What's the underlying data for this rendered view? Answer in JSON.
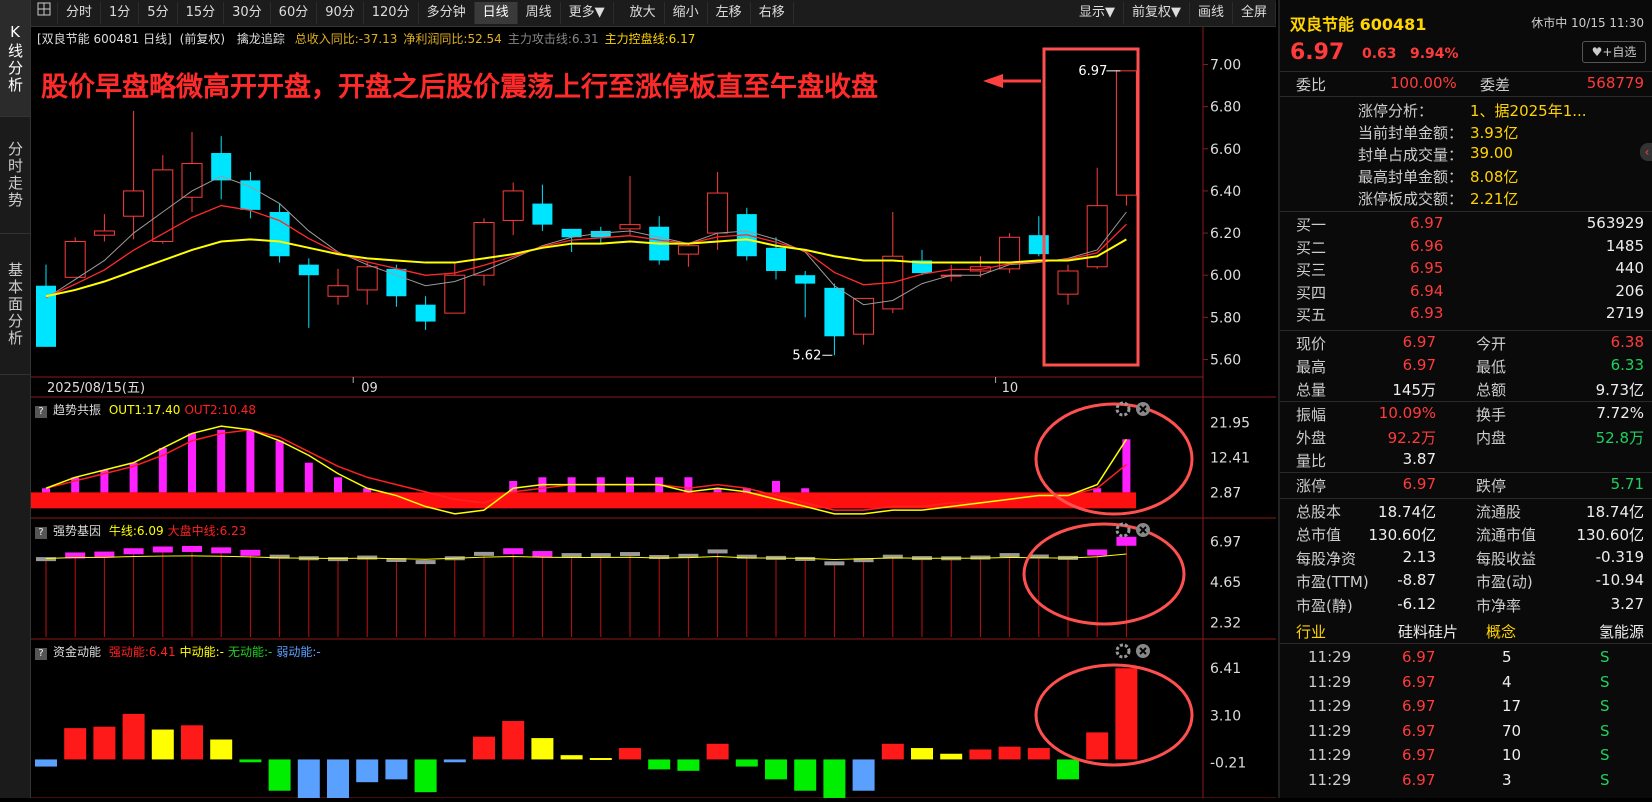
{
  "sidebar": {
    "tabs": [
      "K线分析",
      "分时走势",
      "基本面分析"
    ]
  },
  "toolbar": {
    "periods": [
      "分时",
      "1分",
      "5分",
      "15分",
      "30分",
      "60分",
      "90分",
      "120分",
      "多分钟",
      "日线",
      "周线",
      "更多▼"
    ],
    "selected": "日线",
    "tools": [
      "放大",
      "缩小",
      "左移",
      "右移"
    ],
    "right": [
      "显示▼",
      "前复权▼",
      "画线",
      "全屏"
    ]
  },
  "main_panel": {
    "stock_label": "[双良节能 600481 日线]",
    "adjust": "(前复权)",
    "indicator": "擒龙追踪",
    "metrics": [
      {
        "text": "总收入同比:-37.13",
        "color": "#e0b020"
      },
      {
        "text": "净利润同比:52.54",
        "color": "#e0b020"
      },
      {
        "text": "主力攻击线:6.31",
        "color": "#888888"
      },
      {
        "text": "主力控盘线:6.17",
        "color": "#ffd400"
      }
    ],
    "annotation": "股价早盘略微高开开盘，开盘之后股价震荡上行至涨停板直至午盘收盘",
    "y_ticks": [
      "7.00",
      "6.80",
      "6.60",
      "6.40",
      "6.20",
      "6.00",
      "5.80",
      "5.60"
    ],
    "high_label": "6.97",
    "low_label": "5.62",
    "x_labels": [
      "2025/08/15(五)",
      "09",
      "10"
    ]
  },
  "chart_data": [
    {
      "type": "candlestick",
      "title": "双良节能 600481 日线",
      "ylim": [
        5.55,
        7.05
      ],
      "candles": [
        [
          5.95,
          5.66,
          6.05,
          5.66
        ],
        [
          5.99,
          6.16,
          6.18,
          5.99
        ],
        [
          6.19,
          6.21,
          6.29,
          6.16
        ],
        [
          6.28,
          6.4,
          6.78,
          6.17
        ],
        [
          6.16,
          6.5,
          6.57,
          6.15
        ],
        [
          6.37,
          6.53,
          6.68,
          6.3
        ],
        [
          6.58,
          6.45,
          6.66,
          6.36
        ],
        [
          6.45,
          6.31,
          6.49,
          6.27
        ],
        [
          6.3,
          6.09,
          6.34,
          6.06
        ],
        [
          6.05,
          6.0,
          6.08,
          5.75
        ],
        [
          5.9,
          5.95,
          6.03,
          5.86
        ],
        [
          5.93,
          6.04,
          6.06,
          5.86
        ],
        [
          6.03,
          5.9,
          6.05,
          5.85
        ],
        [
          5.86,
          5.78,
          5.9,
          5.74
        ],
        [
          5.82,
          6.0,
          6.06,
          5.82
        ],
        [
          6.0,
          6.25,
          6.27,
          5.95
        ],
        [
          6.26,
          6.4,
          6.44,
          6.19
        ],
        [
          6.34,
          6.24,
          6.43,
          6.21
        ],
        [
          6.22,
          6.18,
          6.21,
          6.11
        ],
        [
          6.21,
          6.18,
          6.23,
          6.15
        ],
        [
          6.22,
          6.24,
          6.47,
          6.19
        ],
        [
          6.23,
          6.07,
          6.28,
          6.05
        ],
        [
          6.1,
          6.14,
          6.15,
          6.04
        ],
        [
          6.2,
          6.39,
          6.49,
          6.12
        ],
        [
          6.29,
          6.09,
          6.32,
          6.07
        ],
        [
          6.13,
          6.02,
          6.18,
          5.98
        ],
        [
          6.0,
          5.96,
          6.02,
          5.8
        ],
        [
          5.94,
          5.71,
          5.96,
          5.62
        ],
        [
          5.72,
          5.89,
          5.89,
          5.67
        ],
        [
          5.84,
          6.09,
          6.3,
          5.82
        ],
        [
          6.07,
          6.01,
          6.12,
          6.0
        ],
        [
          6.0,
          6.0,
          6.05,
          5.97
        ],
        [
          6.02,
          6.04,
          6.09,
          5.99
        ],
        [
          6.03,
          6.18,
          6.2,
          6.01
        ],
        [
          6.19,
          6.1,
          6.28,
          6.09
        ],
        [
          5.91,
          6.02,
          6.05,
          5.86
        ],
        [
          6.04,
          6.33,
          6.51,
          6.03
        ],
        [
          6.38,
          6.97,
          6.97,
          6.33
        ]
      ],
      "ma_gray": [
        5.89,
        5.98,
        6.07,
        6.2,
        6.3,
        6.4,
        6.47,
        6.42,
        6.34,
        6.21,
        6.11,
        6.05,
        6.0,
        5.95,
        5.97,
        6.02,
        6.08,
        6.14,
        6.18,
        6.2,
        6.21,
        6.18,
        6.15,
        6.2,
        6.21,
        6.17,
        6.11,
        5.95,
        5.86,
        5.88,
        5.96,
        6.0,
        6.0,
        6.05,
        6.06,
        6.08,
        6.12,
        6.3
      ],
      "ma_red": [
        5.89,
        5.98,
        6.07,
        6.2,
        6.3,
        6.4,
        6.47,
        6.42,
        6.34,
        6.21,
        6.11,
        6.05,
        6.0,
        5.95,
        5.97,
        6.02,
        6.08,
        6.14,
        6.18,
        6.2,
        6.21,
        6.18,
        6.15,
        6.2,
        6.21,
        6.17,
        6.11,
        5.95,
        5.86,
        5.88,
        5.96,
        6.0,
        6.0,
        6.05,
        6.06,
        6.08,
        6.12,
        6.3
      ],
      "ma_yellow": [
        5.9,
        5.93,
        5.97,
        6.02,
        6.07,
        6.12,
        6.16,
        6.17,
        6.16,
        6.13,
        6.1,
        6.08,
        6.07,
        6.06,
        6.06,
        6.08,
        6.1,
        6.13,
        6.15,
        6.15,
        6.16,
        6.15,
        6.15,
        6.16,
        6.17,
        6.14,
        6.12,
        6.09,
        6.07,
        6.07,
        6.06,
        6.06,
        6.06,
        6.06,
        6.07,
        6.07,
        6.09,
        6.17
      ]
    },
    {
      "type": "bar",
      "title": "趋势共振",
      "ylim": [
        -2.5,
        23.5
      ],
      "y_ticks": [
        "21.95",
        "12.41",
        "2.87"
      ],
      "series": [
        {
          "name": "OUT1",
          "label": "OUT1:17.40",
          "color": "#ffff00"
        },
        {
          "name": "OUT2",
          "label": "OUT2:10.48",
          "color": "#ff2020"
        }
      ],
      "bars": [
        4,
        7,
        9,
        11,
        15,
        19,
        20,
        20,
        17,
        11,
        7,
        4,
        2,
        0,
        0,
        0,
        6,
        7,
        7,
        7,
        7,
        7,
        7,
        4,
        4,
        6,
        4,
        0,
        0,
        0,
        0,
        0,
        0,
        0,
        0,
        0,
        4,
        17.4
      ],
      "line_yellow": [
        4,
        7,
        9,
        11,
        15,
        19,
        21,
        20,
        17,
        13,
        8,
        4,
        2,
        -1,
        -3,
        -2,
        4,
        5,
        5,
        5,
        5,
        5,
        3,
        4,
        3,
        1,
        -1,
        -3,
        -3,
        -2,
        -2,
        -1,
        0,
        1,
        2,
        2,
        5,
        17.4
      ],
      "line_red": [
        4,
        6,
        8,
        10,
        13,
        17,
        19,
        20,
        18,
        14,
        10,
        7,
        5,
        3,
        1,
        0,
        3,
        4,
        5,
        5,
        5,
        5,
        4,
        5,
        4,
        2,
        0,
        -2,
        -2,
        -1,
        -1,
        0,
        0,
        1,
        2,
        2,
        4,
        10.48
      ],
      "band": [
        0,
        2.87
      ]
    },
    {
      "type": "bar",
      "title": "强势基因",
      "ylim": [
        1.5,
        7.5
      ],
      "y_ticks": [
        "6.97",
        "4.65",
        "2.32"
      ],
      "series": [
        {
          "name": "牛线",
          "label": "牛线:6.09",
          "color": "#ffff00"
        },
        {
          "name": "大盘中线",
          "label": "大盘中线:6.23",
          "color": "#ff2020"
        }
      ],
      "values": [
        5.95,
        6.16,
        6.21,
        6.4,
        6.5,
        6.53,
        6.45,
        6.31,
        6.09,
        6.0,
        5.95,
        6.04,
        5.9,
        5.78,
        6.0,
        6.25,
        6.4,
        6.24,
        6.18,
        6.18,
        6.24,
        6.07,
        6.14,
        6.39,
        6.09,
        6.02,
        5.96,
        5.71,
        5.89,
        6.09,
        6.01,
        6.0,
        6.04,
        6.18,
        6.1,
        6.02,
        6.33,
        6.97
      ],
      "strong": [
        0,
        1,
        1,
        1,
        1,
        1,
        1,
        1,
        0,
        0,
        0,
        0,
        0,
        0,
        0,
        0,
        1,
        1,
        0,
        0,
        0,
        0,
        0,
        0,
        0,
        0,
        0,
        0,
        0,
        0,
        0,
        0,
        0,
        0,
        0,
        0,
        1,
        1
      ]
    },
    {
      "type": "bar",
      "title": "资金动能",
      "ylim": [
        -2.5,
        7.2
      ],
      "y_ticks": [
        "6.41",
        "3.10",
        "-0.21"
      ],
      "series": [
        {
          "name": "强动能",
          "label": "强动能:6.41",
          "color": "#ff2020"
        },
        {
          "name": "中动能",
          "label": "中动能:-",
          "color": "#ffff00"
        },
        {
          "name": "无动能",
          "label": "无动能:-",
          "color": "#20d020"
        },
        {
          "name": "弱动能",
          "label": "弱动能:-",
          "color": "#5aa0ff"
        }
      ],
      "values": [
        -0.5,
        2.2,
        2.3,
        3.2,
        2.1,
        2.4,
        1.4,
        -0.2,
        -2.2,
        -3.2,
        -2.8,
        -1.6,
        -1.4,
        -2.3,
        -0.2,
        1.6,
        2.7,
        1.5,
        0.3,
        0.1,
        0.8,
        -0.7,
        -0.8,
        1.1,
        -0.5,
        -1.4,
        -2.2,
        -3.1,
        -2.2,
        1.1,
        0.8,
        0.4,
        0.7,
        0.9,
        0.8,
        -1.4,
        1.9,
        6.41
      ],
      "kinds": [
        "weak",
        "strong",
        "strong",
        "strong",
        "mid",
        "strong",
        "mid",
        "none",
        "none",
        "weak",
        "weak",
        "weak",
        "weak",
        "none",
        "weak",
        "strong",
        "strong",
        "mid",
        "mid",
        "mid",
        "strong",
        "none",
        "none",
        "strong",
        "none",
        "none",
        "none",
        "none",
        "weak",
        "strong",
        "mid",
        "mid",
        "strong",
        "strong",
        "strong",
        "none",
        "strong",
        "strong"
      ]
    }
  ],
  "quote": {
    "name": "双良节能 600481",
    "status": "休市中 10/15 11:30",
    "price": "6.97",
    "change": "0.63",
    "pct": "9.94%",
    "fav_button": "+自选",
    "weibi_label": "委比",
    "weibi": "100.00%",
    "weicha_label": "委差",
    "weicha": "568779"
  },
  "limit_up": {
    "rows": [
      {
        "label": "涨停分析：",
        "value": "1、据2025年1..."
      },
      {
        "label": "当前封单金额：",
        "value": "3.93亿"
      },
      {
        "label": "封单占成交量：",
        "value": "39.00"
      },
      {
        "label": "最高封单金额：",
        "value": "8.08亿"
      },
      {
        "label": "涨停板成交额：",
        "value": "2.21亿"
      }
    ]
  },
  "order_book": [
    {
      "label": "买一",
      "price": "6.97",
      "vol": "563929"
    },
    {
      "label": "买二",
      "price": "6.96",
      "vol": "1485"
    },
    {
      "label": "买三",
      "price": "6.95",
      "vol": "440"
    },
    {
      "label": "买四",
      "price": "6.94",
      "vol": "206"
    },
    {
      "label": "买五",
      "price": "6.93",
      "vol": "2719"
    }
  ],
  "stats1": [
    {
      "l1": "现价",
      "v1": "6.97",
      "c1": "red",
      "l2": "今开",
      "v2": "6.38",
      "c2": "red"
    },
    {
      "l1": "最高",
      "v1": "6.97",
      "c1": "red",
      "l2": "最低",
      "v2": "6.33",
      "c2": "green"
    },
    {
      "l1": "总量",
      "v1": "145万",
      "c1": "white",
      "l2": "总额",
      "v2": "9.73亿",
      "c2": "white"
    }
  ],
  "stats2": [
    {
      "l1": "振幅",
      "v1": "10.09%",
      "c1": "red",
      "l2": "换手",
      "v2": "7.72%",
      "c2": "white"
    },
    {
      "l1": "外盘",
      "v1": "92.2万",
      "c1": "red",
      "l2": "内盘",
      "v2": "52.8万",
      "c2": "green"
    },
    {
      "l1": "量比",
      "v1": "3.87",
      "c1": "white",
      "l2": "",
      "v2": "",
      "c2": "white"
    }
  ],
  "stats3": [
    {
      "l1": "涨停",
      "v1": "6.97",
      "c1": "red",
      "l2": "跌停",
      "v2": "5.71",
      "c2": "green"
    }
  ],
  "stats4": [
    {
      "l1": "总股本",
      "v1": "18.74亿",
      "c1": "white",
      "l2": "流通股",
      "v2": "18.74亿",
      "c2": "white"
    },
    {
      "l1": "总市值",
      "v1": "130.60亿",
      "c1": "white",
      "l2": "流通市值",
      "v2": "130.60亿",
      "c2": "white"
    },
    {
      "l1": "每股净资",
      "v1": "2.13",
      "c1": "white",
      "l2": "每股收益",
      "v2": "-0.319",
      "c2": "white"
    },
    {
      "l1": "市盈(TTM)",
      "v1": "-8.87",
      "c1": "white",
      "l2": "市盈(动)",
      "v2": "-10.94",
      "c2": "white"
    },
    {
      "l1": "市盈(静)",
      "v1": "-6.12",
      "c1": "white",
      "l2": "市净率",
      "v2": "3.27",
      "c2": "white"
    }
  ],
  "industry": {
    "label": "行业",
    "value": "硅料硅片",
    "concept_label": "概念",
    "concept": "氢能源"
  },
  "ticks": [
    {
      "time": "11:29",
      "price": "6.97",
      "vol": "5",
      "flag": "S"
    },
    {
      "time": "11:29",
      "price": "6.97",
      "vol": "4",
      "flag": "S"
    },
    {
      "time": "11:29",
      "price": "6.97",
      "vol": "17",
      "flag": "S"
    },
    {
      "time": "11:29",
      "price": "6.97",
      "vol": "70",
      "flag": "S"
    },
    {
      "time": "11:29",
      "price": "6.97",
      "vol": "10",
      "flag": "S"
    },
    {
      "time": "11:29",
      "price": "6.97",
      "vol": "3",
      "flag": "S"
    }
  ],
  "colors": {
    "up": "#ff3b3b",
    "down": "#00e5ff",
    "accent": "#ffd400",
    "highlight": "#ff5050"
  }
}
